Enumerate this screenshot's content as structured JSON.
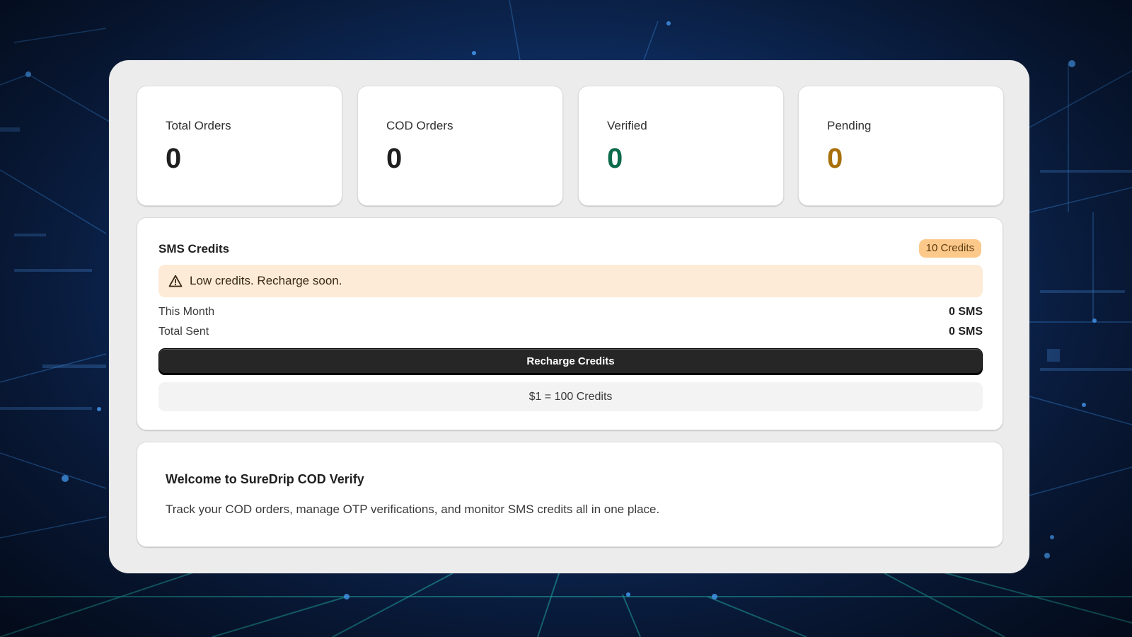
{
  "colors": {
    "background": "#0d2a5a",
    "panel": "#ececec",
    "card": "#ffffff",
    "verified_value": "#0d6b4c",
    "pending_value": "#a87009",
    "credits_badge": "#fcc98b",
    "warning_banner": "#fdebd7",
    "primary_button": "#262626"
  },
  "stats": [
    {
      "label": "Total Orders",
      "value": "0"
    },
    {
      "label": "COD Orders",
      "value": "0"
    },
    {
      "label": "Verified",
      "value": "0"
    },
    {
      "label": "Pending",
      "value": "0"
    }
  ],
  "sms_credits": {
    "title": "SMS Credits",
    "badge": "10 Credits",
    "warning_icon": "alert-triangle-icon",
    "warning": "Low credits. Recharge soon.",
    "rows": [
      {
        "label": "This Month",
        "value": "0 SMS"
      },
      {
        "label": "Total Sent",
        "value": "0 SMS"
      }
    ],
    "recharge_button": "Recharge Credits",
    "rate": "$1 = 100 Credits"
  },
  "welcome": {
    "title": "Welcome to SureDrip COD Verify",
    "description": "Track your COD orders, manage OTP verifications, and monitor SMS credits all in one place."
  }
}
